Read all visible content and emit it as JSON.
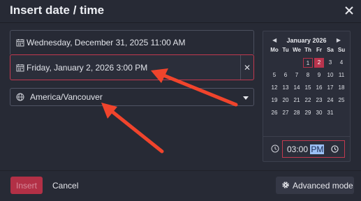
{
  "dialog": {
    "title": "Insert date / time",
    "close_icon": "close-icon"
  },
  "start_field": {
    "value": "Wednesday, December 31, 2025 11:00 AM",
    "icon": "calendar-icon"
  },
  "end_field": {
    "value": "Friday, January 2, 2026 3:00 PM",
    "icon": "calendar-icon",
    "clear_label": "✕"
  },
  "timezone_field": {
    "value": "America/Vancouver",
    "icon": "globe-icon"
  },
  "calendar": {
    "month_label": "January  2026",
    "prev": "◀",
    "next": "▶",
    "weekdays": [
      "Mo",
      "Tu",
      "We",
      "Th",
      "Fr",
      "Sa",
      "Su"
    ],
    "weeks": [
      [
        "",
        "",
        "",
        "1",
        "2",
        "3",
        "4"
      ],
      [
        "5",
        "6",
        "7",
        "8",
        "9",
        "10",
        "11"
      ],
      [
        "12",
        "13",
        "14",
        "15",
        "16",
        "17",
        "18"
      ],
      [
        "19",
        "20",
        "21",
        "22",
        "23",
        "24",
        "25"
      ],
      [
        "26",
        "27",
        "28",
        "29",
        "30",
        "31",
        ""
      ]
    ],
    "selected_day": "2",
    "today_day": "1",
    "time_value": "03:00",
    "time_ampm": "PM"
  },
  "footer": {
    "insert_label": "Insert",
    "cancel_label": "Cancel",
    "advanced_label": "Advanced mode"
  },
  "colors": {
    "accent": "#c2394f",
    "annotation_arrow": "#f0442c",
    "background": "#272a35"
  }
}
